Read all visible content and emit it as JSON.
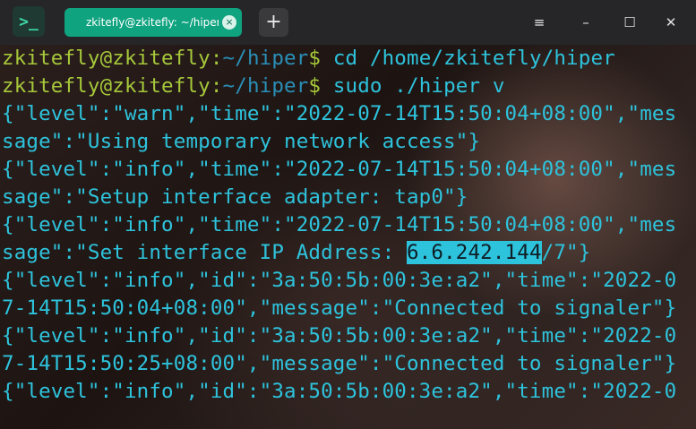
{
  "app": {
    "icon_name": "terminal-app-icon",
    "tab_title": "zkitefly@zkitefly: ~/hiper",
    "tab_close_glyph": "×",
    "new_tab_glyph": "+",
    "menu_glyph": "≡",
    "minimize_glyph": "–",
    "maximize_glyph": "☐",
    "close_glyph": "✕"
  },
  "colors": {
    "accent": "#0fa37f",
    "prompt_user": "#a6c83a",
    "prompt_path": "#2a8fb8",
    "output": "#2ec3dc"
  },
  "terminal": {
    "prompt_user_host": "zkitefly@zkitefly",
    "prompt_sep": ":",
    "prompt_path": "~/hiper",
    "prompt_symbol": "$",
    "cmd1": " cd /home/zkitefly/hiper",
    "cmd2": " sudo ./hiper v",
    "lines": [
      "{\"level\":\"warn\",\"time\":\"2022-07-14T15:50:04+08:00\",\"mes",
      "sage\":\"Using temporary network access\"}",
      "{\"level\":\"info\",\"time\":\"2022-07-14T15:50:04+08:00\",\"mes",
      "sage\":\"Setup interface adapter: tap0\"}",
      "{\"level\":\"info\",\"time\":\"2022-07-14T15:50:04+08:00\",\"mes",
      "sage\":\"Set interface IP Address: ",
      "{\"level\":\"info\",\"id\":\"3a:50:5b:00:3e:a2\",\"time\":\"2022-0",
      "7-14T15:50:04+08:00\",\"message\":\"Connected to signaler\"}",
      "{\"level\":\"info\",\"id\":\"3a:50:5b:00:3e:a2\",\"time\":\"2022-0",
      "7-14T15:50:25+08:00\",\"message\":\"Connected to signaler\"}",
      "{\"level\":\"info\",\"id\":\"3a:50:5b:00:3e:a2\",\"time\":\"2022-0"
    ],
    "ip_highlight": "6.6.242.144",
    "ip_suffix": "/7\"}"
  }
}
